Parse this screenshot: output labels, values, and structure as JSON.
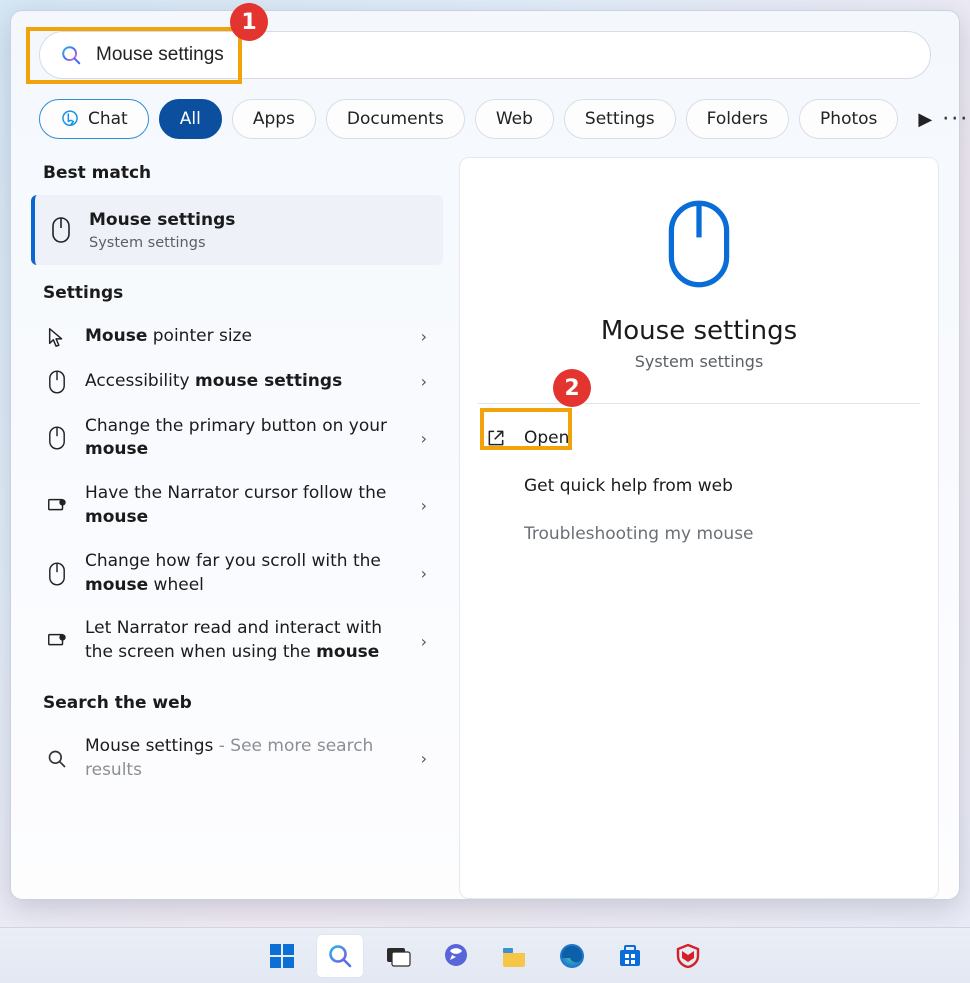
{
  "annotations": {
    "b1": "1",
    "b2": "2"
  },
  "search": {
    "value": "Mouse settings"
  },
  "filters": {
    "chat": "Chat",
    "all": "All",
    "apps": "Apps",
    "documents": "Documents",
    "web": "Web",
    "settings": "Settings",
    "folders": "Folders",
    "photos": "Photos"
  },
  "left": {
    "best_match": "Best match",
    "best_result": {
      "title": "Mouse settings",
      "subtitle": "System settings"
    },
    "settings_head": "Settings",
    "items": [
      {
        "pre": "Mouse",
        "post": " pointer size"
      },
      {
        "pre2": "Accessibility ",
        "bold": "mouse settings"
      },
      {
        "pre2": "Change the primary button on your ",
        "bold": "mouse"
      },
      {
        "pre2": "Have the Narrator cursor follow the ",
        "bold": "mouse"
      },
      {
        "pre2": "Change how far you scroll with the ",
        "bold": "mouse",
        "post": " wheel"
      },
      {
        "pre2": "Let Narrator read and interact with the screen when using the ",
        "bold": "mouse"
      }
    ],
    "web_head": "Search the web",
    "web_item": {
      "title": "Mouse settings",
      "hint": " - See more search results"
    }
  },
  "right": {
    "title": "Mouse settings",
    "subtitle": "System settings",
    "open": "Open",
    "quickhelp": "Get quick help from web",
    "troubleshoot": "Troubleshooting my mouse"
  }
}
